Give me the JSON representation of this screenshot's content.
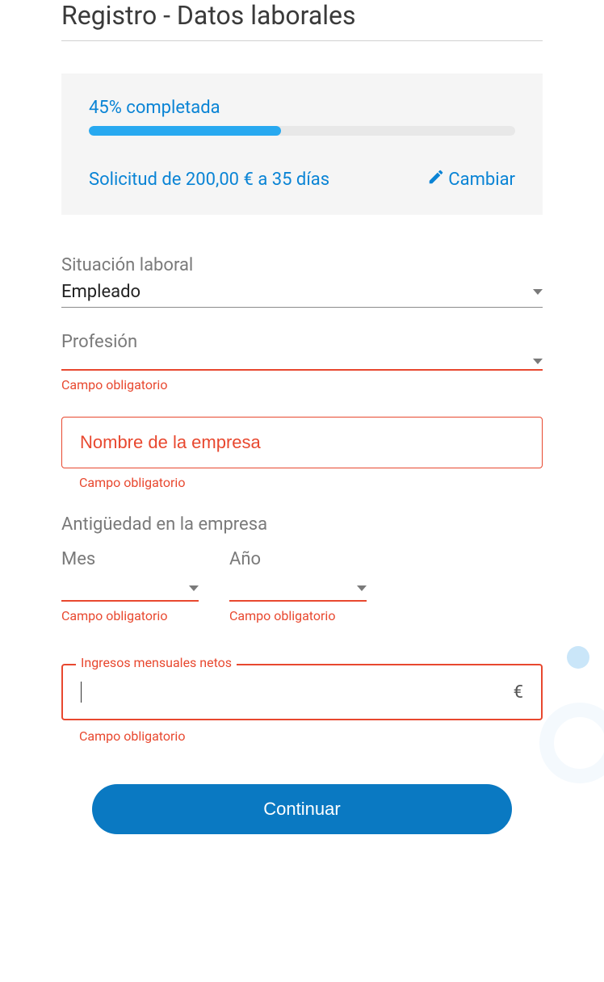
{
  "title": "Registro - Datos laborales",
  "progress": {
    "label": "45% completada",
    "percent": 45
  },
  "summary": {
    "text": "Solicitud de 200,00 € a 35 días",
    "change_label": "Cambiar"
  },
  "fields": {
    "situation": {
      "label": "Situación laboral",
      "value": "Empleado"
    },
    "profession": {
      "label": "Profesión",
      "value": "",
      "error": "Campo obligatorio"
    },
    "company": {
      "placeholder": "Nombre de la empresa",
      "error": "Campo obligatorio"
    },
    "seniority": {
      "heading": "Antigüedad en la empresa",
      "month": {
        "label": "Mes",
        "error": "Campo obligatorio"
      },
      "year": {
        "label": "Año",
        "error": "Campo obligatorio"
      }
    },
    "income": {
      "label": "Ingresos mensuales netos",
      "suffix": "€",
      "error": "Campo obligatorio"
    }
  },
  "continue_label": "Continuar"
}
